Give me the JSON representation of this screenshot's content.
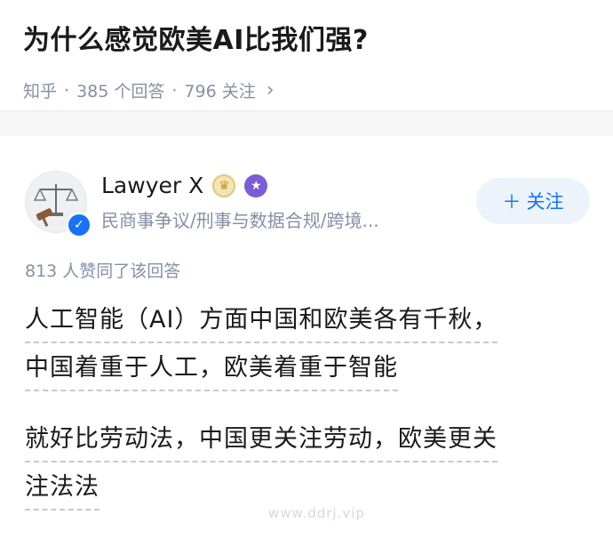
{
  "question": {
    "title": "为什么感觉欧美AI比我们强?",
    "source": "知乎",
    "answers_count": "385 个回答",
    "followers_count": "796 关注"
  },
  "author": {
    "name": "Lawyer X",
    "headline": "民商事争议/刑事与数据合规/跨境...",
    "follow_label": "关注",
    "follow_icon": "plus-icon",
    "badges": [
      "crown-badge-icon",
      "star-badge-icon"
    ]
  },
  "answer": {
    "upvote_text": "813 人赞同了该回答",
    "paragraphs": [
      [
        "人工智能（AI）方面中国和欧美各有千秋，",
        "中国着重于人工，欧美着重于智能"
      ],
      [
        "就好比劳动法，中国更关注劳动，欧美更关",
        "注法法"
      ]
    ]
  },
  "watermark": "www.ddrj.vip",
  "colors": {
    "accent": "#1772f6",
    "meta_gray": "#8590a6",
    "follow_bg": "#ecf3fb"
  }
}
